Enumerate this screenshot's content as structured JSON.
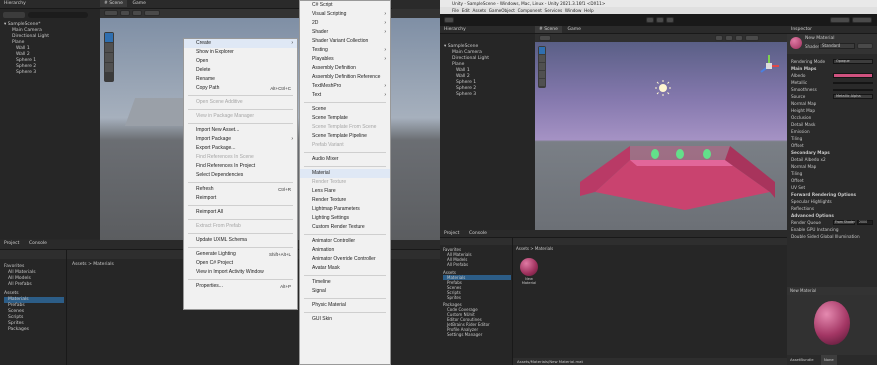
{
  "left": {
    "hierarchy_tab": "Hierarchy",
    "scene_tabs": [
      "# Scene",
      "Game"
    ],
    "hierarchy_items": [
      "SampleScene*",
      "Main Camera",
      "Directional Light",
      "Plane",
      "Wall 1",
      "Wall 2",
      "Sphere 1",
      "Sphere 2",
      "Sphere 3"
    ],
    "project_tab": "Project",
    "console_tab": "Console",
    "favorites": [
      "Favorites",
      "All Materials",
      "All Models",
      "All Prefabs"
    ],
    "assets": [
      "Assets",
      "Materials",
      "Prefabs",
      "Scenes",
      "Scripts",
      "Sprites",
      "Packages"
    ],
    "breadcrumb": "Assets > Materials",
    "context_menu": [
      {
        "label": "Create",
        "arrow": true,
        "hl": true
      },
      {
        "label": "Show in Explorer"
      },
      {
        "label": "Open"
      },
      {
        "label": "Delete"
      },
      {
        "label": "Rename"
      },
      {
        "label": "Copy Path",
        "shortcut": "Alt+Ctrl+C"
      },
      {
        "sep": true
      },
      {
        "label": "Open Scene Additive",
        "dis": true
      },
      {
        "sep": true
      },
      {
        "label": "View in Package Manager",
        "dis": true
      },
      {
        "sep": true
      },
      {
        "label": "Import New Asset..."
      },
      {
        "label": "Import Package",
        "arrow": true
      },
      {
        "label": "Export Package..."
      },
      {
        "label": "Find References In Scene",
        "dis": true
      },
      {
        "label": "Find References In Project"
      },
      {
        "label": "Select Dependencies"
      },
      {
        "sep": true
      },
      {
        "label": "Refresh",
        "shortcut": "Ctrl+R"
      },
      {
        "label": "Reimport"
      },
      {
        "sep": true
      },
      {
        "label": "Reimport All"
      },
      {
        "sep": true
      },
      {
        "label": "Extract From Prefab",
        "dis": true
      },
      {
        "sep": true
      },
      {
        "label": "Update UXML Schema"
      },
      {
        "sep": true
      },
      {
        "label": "Generate Lighting",
        "shortcut": "Shift+Alt+L"
      },
      {
        "label": "Open C# Project"
      },
      {
        "label": "View in Import Activity Window"
      },
      {
        "sep": true
      },
      {
        "label": "Properties...",
        "shortcut": "Alt+P"
      }
    ],
    "submenu": [
      {
        "label": "C# Script"
      },
      {
        "label": "Visual Scripting",
        "arrow": true
      },
      {
        "label": "2D",
        "arrow": true
      },
      {
        "label": "Shader",
        "arrow": true
      },
      {
        "label": "Shader Variant Collection"
      },
      {
        "label": "Testing",
        "arrow": true
      },
      {
        "label": "Playables",
        "arrow": true
      },
      {
        "label": "Assembly Definition"
      },
      {
        "label": "Assembly Definition Reference"
      },
      {
        "label": "TextMeshPro",
        "arrow": true
      },
      {
        "label": "Text",
        "arrow": true
      },
      {
        "sep": true
      },
      {
        "label": "Scene"
      },
      {
        "label": "Scene Template"
      },
      {
        "label": "Scene Template From Scene",
        "dis": true
      },
      {
        "label": "Scene Template Pipeline"
      },
      {
        "label": "Prefab Variant",
        "dis": true
      },
      {
        "sep": true
      },
      {
        "label": "Audio Mixer"
      },
      {
        "sep": true
      },
      {
        "label": "Material",
        "hl": true
      },
      {
        "label": "Render Texture",
        "dis": true
      },
      {
        "label": "Lens Flare"
      },
      {
        "label": "Render Texture"
      },
      {
        "label": "Lightmap Parameters"
      },
      {
        "label": "Lighting Settings"
      },
      {
        "label": "Custom Render Texture"
      },
      {
        "sep": true
      },
      {
        "label": "Animator Controller"
      },
      {
        "label": "Animation"
      },
      {
        "label": "Animator Override Controller"
      },
      {
        "label": "Avatar Mask"
      },
      {
        "sep": true
      },
      {
        "label": "Timeline"
      },
      {
        "label": "Signal"
      },
      {
        "sep": true
      },
      {
        "label": "Physic Material"
      },
      {
        "sep": true
      },
      {
        "label": "GUI Skin"
      }
    ]
  },
  "right": {
    "window_title": "Unity - SampleScene - Windows, Mac, Linux - Unity 2021.3.16f1 <DX11>",
    "menubar": [
      "File",
      "Edit",
      "Assets",
      "GameObject",
      "Component",
      "Services",
      "Window",
      "Help"
    ],
    "hierarchy_tab": "Hierarchy",
    "scene_tabs": [
      "# Scene",
      "Game"
    ],
    "hierarchy_items": [
      "SampleScene",
      "Main Camera",
      "Directional Light",
      "Plane",
      "Wall 1",
      "Wall 2",
      "Sphere 1",
      "Sphere 2",
      "Sphere 3"
    ],
    "project_tab": "Project",
    "console_tab": "Console",
    "breadcrumb": "Assets > Materials",
    "favorites": [
      "Favorites",
      "All Materials",
      "All Models",
      "All Prefabs"
    ],
    "assets": [
      "Assets",
      "Materials",
      "Prefabs",
      "Scenes",
      "Scripts",
      "Sprites",
      "Packages",
      "Code Coverage",
      "Custom NUnit",
      "Editor Coroutines",
      "JetBrains Rider Editor",
      "Profile Analyzer",
      "Settings Manager"
    ],
    "material_name": "New Material",
    "footer_path": "Assets/Materials/New Material.mat",
    "inspector_tab": "Inspector",
    "inspector_title": "New Material",
    "shader_label": "Shader",
    "shader_value": "Standard",
    "inspector_rows": [
      "Rendering Mode",
      "Main Maps",
      "Albedo",
      "Metallic",
      "Smoothness",
      "Source",
      "Normal Map",
      "Height Map",
      "Occlusion",
      "Detail Mask",
      "Emission",
      "Tiling",
      "Offset",
      "Secondary Maps",
      "Detail Albedo x2",
      "Normal Map",
      "Tiling",
      "Offset",
      "UV Set",
      "Forward Rendering Options",
      "Specular Highlights",
      "Reflections",
      "Advanced Options",
      "Render Queue",
      "Enable GPU Instancing",
      "Double Sided Global Illumination"
    ],
    "rendering_mode_value": "Opaque",
    "source_value": "Metallic Alpha",
    "render_queue_value": "From Shader",
    "render_queue_number": "2000",
    "preview_label": "New Material",
    "assetbundle_label": "AssetBundle",
    "assetbundle_value": "None"
  },
  "colors": {
    "accent_blue": "#2c5d87",
    "wall_pink": "#d4477a",
    "albedo_pink": "#d0527f",
    "sky_top": "#5a5f86",
    "sky_horizon": "#a592c4",
    "ground": "#7a7f86"
  }
}
